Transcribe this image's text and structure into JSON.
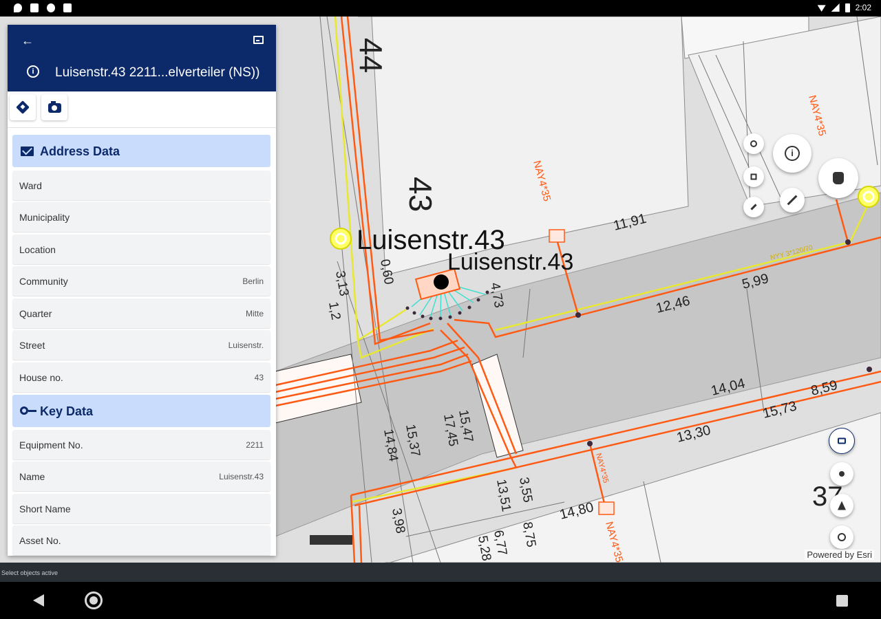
{
  "statusbar": {
    "time": "2:02"
  },
  "panel": {
    "title": "Luisenstr.43 2211...elverteiler (NS))",
    "sections": [
      {
        "header": "Address Data",
        "icon": "mail-icon",
        "rows": [
          {
            "label": "Ward",
            "value": ""
          },
          {
            "label": "Municipality",
            "value": ""
          },
          {
            "label": "Location",
            "value": ""
          },
          {
            "label": "Community",
            "value": "Berlin"
          },
          {
            "label": "Quarter",
            "value": "Mitte"
          },
          {
            "label": "Street",
            "value": "Luisenstr."
          },
          {
            "label": "House no.",
            "value": "43"
          }
        ]
      },
      {
        "header": "Key Data",
        "icon": "key-icon",
        "rows": [
          {
            "label": "Equipment No.",
            "value": "2211"
          },
          {
            "label": "Name",
            "value": "Luisenstr.43"
          },
          {
            "label": "Short Name",
            "value": ""
          },
          {
            "label": "Asset No.",
            "value": ""
          }
        ]
      }
    ]
  },
  "map": {
    "labels": {
      "parcel_44": "44",
      "parcel_43": "43",
      "parcel_37": "37",
      "street_big": "Luisenstr.43",
      "street_small": "Luisenstr.43",
      "cable_1": "NAY4*35",
      "cable_2": "NAY4*35",
      "cable_3": "NAY4*35",
      "cable_4": "NAY4*35",
      "cable_5": "NYY 3*120/70",
      "m_1191": "11,91",
      "m_599": "5,99",
      "m_1246": "12,46",
      "m_1404": "14,04",
      "m_859": "8,59",
      "m_1573": "15,73",
      "m_1330": "13,30",
      "m_1480": "14,80",
      "m_875": "8,75",
      "m_473": "4,73",
      "m_313": "3,13",
      "m_1484": "14,84",
      "m_1537": "15,37",
      "m_1745": "17,45",
      "m_1547": "15,47",
      "m_1351": "13,51",
      "m_355": "3,55",
      "m_398": "3,98",
      "m_677": "6,77",
      "m_528": "5,28",
      "m_060": "0,60",
      "m_12": "1,2"
    },
    "colors": {
      "cable": "#ff5a14",
      "building": "#ffff55",
      "selection": "#40e0d0"
    },
    "esri": "Powered by Esri"
  },
  "hint": "Select objects active"
}
